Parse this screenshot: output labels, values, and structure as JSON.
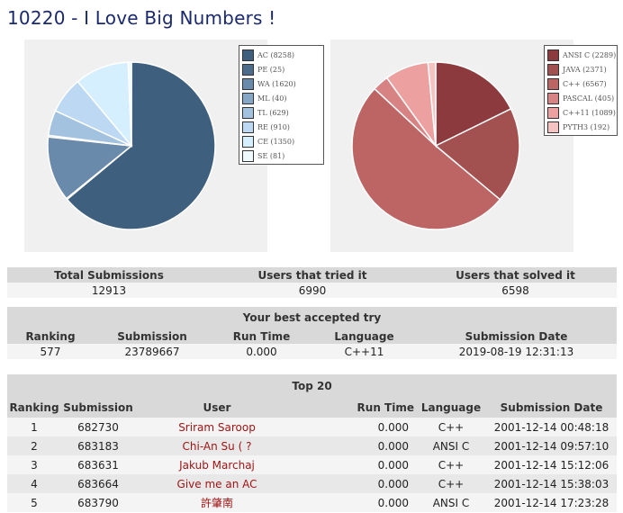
{
  "title": "10220 - I Love Big Numbers !",
  "verdict_chart": {
    "legend": [
      {
        "label": "AC (8258)",
        "value": 8258,
        "color": "#3f5f7f"
      },
      {
        "label": "PE (25)",
        "value": 25,
        "color": "#4d6b8a"
      },
      {
        "label": "WA (1620)",
        "value": 1620,
        "color": "#6a8aab"
      },
      {
        "label": "ML (40)",
        "value": 40,
        "color": "#86a6c6"
      },
      {
        "label": "TL (629)",
        "value": 629,
        "color": "#a3c2e0"
      },
      {
        "label": "RE (910)",
        "value": 910,
        "color": "#bcd8f2"
      },
      {
        "label": "CE (1350)",
        "value": 1350,
        "color": "#d6efff"
      },
      {
        "label": "SE (81)",
        "value": 81,
        "color": "#eefaff"
      }
    ]
  },
  "language_chart": {
    "legend": [
      {
        "label": "ANSI C (2289)",
        "value": 2289,
        "color": "#8c3a3d"
      },
      {
        "label": "JAVA (2371)",
        "value": 2371,
        "color": "#a35050"
      },
      {
        "label": "C++ (6567)",
        "value": 6567,
        "color": "#bd6464"
      },
      {
        "label": "PASCAL (405)",
        "value": 405,
        "color": "#d88383"
      },
      {
        "label": "C++11 (1089)",
        "value": 1089,
        "color": "#eca0a0"
      },
      {
        "label": "PYTH3 (192)",
        "value": 192,
        "color": "#f6c2c2"
      }
    ]
  },
  "stats": {
    "headers": [
      "Total Submissions",
      "Users that tried it",
      "Users that solved it"
    ],
    "values": [
      "12913",
      "6990",
      "6598"
    ]
  },
  "best_try": {
    "caption": "Your best accepted try",
    "headers": [
      "Ranking",
      "Submission",
      "Run Time",
      "Language",
      "Submission Date"
    ],
    "values": [
      "577",
      "23789667",
      "0.000",
      "C++11",
      "2019-08-19 12:31:13"
    ]
  },
  "top20": {
    "caption": "Top 20",
    "headers": [
      "Ranking",
      "Submission",
      "User",
      "Run Time",
      "Language",
      "Submission Date"
    ],
    "rows": [
      [
        "1",
        "682730",
        "Sriram Saroop",
        "0.000",
        "C++",
        "2001-12-14 00:48:18"
      ],
      [
        "2",
        "683183",
        "Chi-An Su ( ?",
        "0.000",
        "ANSI C",
        "2001-12-14 09:57:10"
      ],
      [
        "3",
        "683631",
        "Jakub Marchaj",
        "0.000",
        "C++",
        "2001-12-14 15:12:06"
      ],
      [
        "4",
        "683664",
        "Give me an AC",
        "0.000",
        "C++",
        "2001-12-14 15:38:03"
      ],
      [
        "5",
        "683790",
        "許肇南",
        "0.000",
        "ANSI C",
        "2001-12-14 17:23:28"
      ]
    ]
  }
}
